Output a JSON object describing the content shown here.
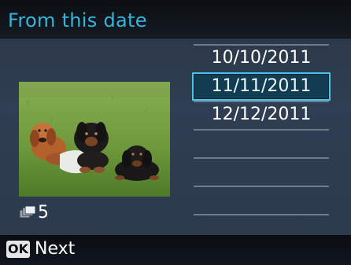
{
  "header": {
    "title": "From this date"
  },
  "photo": {
    "count": "5"
  },
  "dates": [
    {
      "label": "10/10/2011",
      "selected": false
    },
    {
      "label": "11/11/2011",
      "selected": true
    },
    {
      "label": "12/12/2011",
      "selected": false
    },
    {
      "label": "",
      "selected": false
    },
    {
      "label": "",
      "selected": false
    },
    {
      "label": "",
      "selected": false
    }
  ],
  "footer": {
    "ok_key": "OK",
    "action": "Next"
  },
  "colors": {
    "title": "#36b4dc",
    "selection_border": "#46c3e6",
    "selection_fill": "#123c52"
  }
}
